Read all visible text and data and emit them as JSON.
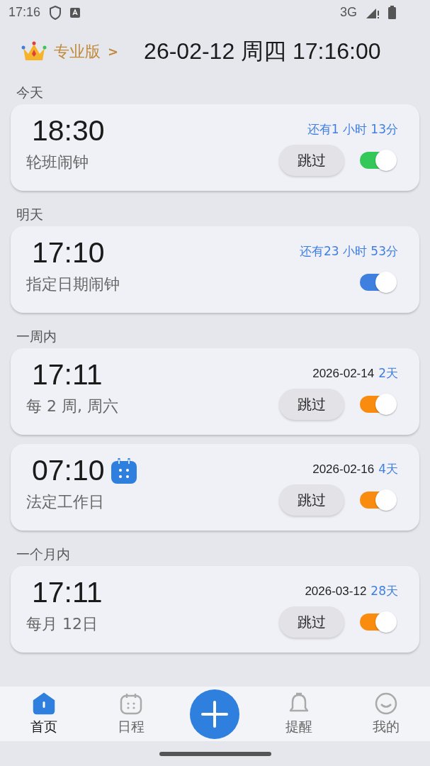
{
  "status_bar": {
    "time": "17:16",
    "network": "3G"
  },
  "header": {
    "pro_label": "专业版",
    "pro_arrow": ">",
    "datetime": "26-02-12 周四 17:16:00"
  },
  "sections": [
    {
      "title": "今天",
      "alarms": [
        {
          "time": "18:30",
          "label": "轮班闹钟",
          "remaining": "还有1 小时 13分",
          "skip": "跳过",
          "on": true,
          "color": "#34c759"
        }
      ]
    },
    {
      "title": "明天",
      "alarms": [
        {
          "time": "17:10",
          "label": "指定日期闹钟",
          "remaining": "还有23 小时 53分",
          "on": true,
          "color": "#3f7fe0"
        }
      ]
    },
    {
      "title": "一周内",
      "alarms": [
        {
          "time": "17:11",
          "label": "每 2 周, 周六",
          "date": "2026-02-14",
          "remaining": "2天",
          "skip": "跳过",
          "on": true,
          "color": "#f98c0f"
        },
        {
          "time": "07:10",
          "calendar_icon": true,
          "label": "法定工作日",
          "date": "2026-02-16",
          "remaining": "4天",
          "skip": "跳过",
          "on": true,
          "color": "#f98c0f"
        }
      ]
    },
    {
      "title": "一个月内",
      "alarms": [
        {
          "time": "17:11",
          "label": "每月 12日",
          "date": "2026-03-12",
          "remaining": "28天",
          "skip": "跳过",
          "on": true,
          "color": "#f98c0f"
        }
      ]
    }
  ],
  "nav": [
    {
      "kind": "home",
      "label": "首页",
      "selected": true
    },
    {
      "kind": "calendar",
      "label": "日程",
      "selected": false
    },
    {
      "kind": "add"
    },
    {
      "kind": "bell",
      "label": "提醒",
      "selected": false
    },
    {
      "kind": "smile",
      "label": "我的",
      "selected": false
    }
  ]
}
